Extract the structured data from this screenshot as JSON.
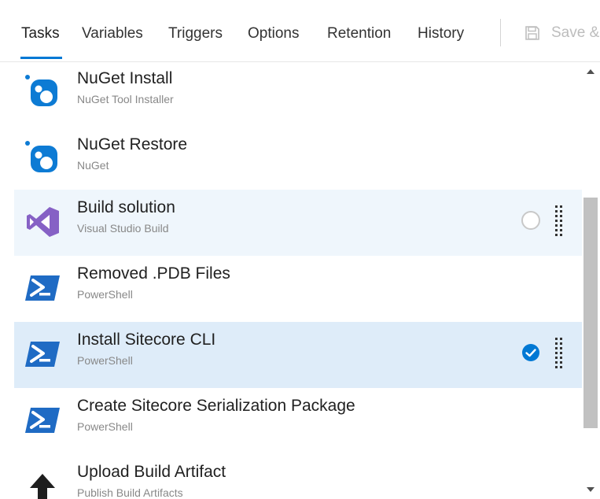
{
  "tabs": [
    {
      "label": "Tasks",
      "active": true
    },
    {
      "label": "Variables"
    },
    {
      "label": "Triggers"
    },
    {
      "label": "Options"
    },
    {
      "label": "Retention"
    },
    {
      "label": "History"
    }
  ],
  "toolbar": {
    "save_label": "Save &",
    "save_icon": "floppy-disk-icon"
  },
  "tasks": [
    {
      "title": "NuGet Install",
      "subtitle": "NuGet Tool Installer",
      "icon": "nuget-icon",
      "state": "none"
    },
    {
      "title": "NuGet Restore",
      "subtitle": "NuGet",
      "icon": "nuget-icon",
      "state": "none"
    },
    {
      "title": "Build solution",
      "subtitle": "Visual Studio Build",
      "icon": "visual-studio-icon",
      "state": "hover-unchecked"
    },
    {
      "title": "Removed .PDB Files",
      "subtitle": "PowerShell",
      "icon": "powershell-icon",
      "state": "none"
    },
    {
      "title": "Install Sitecore CLI",
      "subtitle": "PowerShell",
      "icon": "powershell-icon",
      "state": "selected-checked"
    },
    {
      "title": "Create Sitecore Serialization Package",
      "subtitle": "PowerShell",
      "icon": "powershell-icon",
      "state": "none"
    },
    {
      "title": "Upload Build Artifact",
      "subtitle": "Publish Build Artifacts",
      "icon": "upload-arrow-icon",
      "state": "none"
    }
  ],
  "colors": {
    "accent": "#0078d4",
    "selected_row": "#deecf9",
    "hover_row": "#eff6fc",
    "nuget_blue": "#0d7bd4",
    "visual_studio_purple": "#8661c5",
    "powershell_blue": "#1f6bc4",
    "check_blue": "#0078d4"
  }
}
